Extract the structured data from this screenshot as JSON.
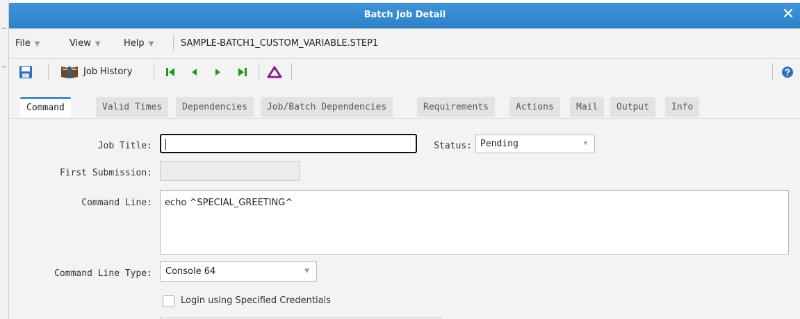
{
  "window": {
    "title": "Batch Job Detail"
  },
  "menu": {
    "file": "File",
    "view": "View",
    "help": "Help",
    "job_path": "SAMPLE-BATCH1_CUSTOM_VARIABLE.STEP1"
  },
  "toolbar": {
    "job_history": "Job History"
  },
  "tabs": [
    {
      "label": "Command"
    },
    {
      "label": "Valid Times"
    },
    {
      "label": "Dependencies"
    },
    {
      "label": "Job/Batch Dependencies"
    },
    {
      "label": "Requirements"
    },
    {
      "label": "Actions"
    },
    {
      "label": "Mail"
    },
    {
      "label": "Output"
    },
    {
      "label": "Info"
    }
  ],
  "form": {
    "job_title_label": "Job Title:",
    "job_title_value": "",
    "status_label": "Status:",
    "status_value": "Pending",
    "first_submission_label": "First Submission:",
    "first_submission_value": "",
    "command_line_label": "Command Line:",
    "command_line_value": "echo ^SPECIAL_GREETING^",
    "command_line_type_label": "Command Line Type:",
    "command_line_type_value": "Console 64",
    "login_credentials_label": "Login using Specified Credentials"
  },
  "colors": {
    "title_bar": "#3a8fd6",
    "active_tab_accent": "#3a8fd6",
    "first_last_arrows": "#1a9a1a",
    "triangle_icon": "#8b1a8b"
  },
  "icons": {
    "close": "close-icon",
    "save": "save-icon",
    "history": "book-icon",
    "first": "first-record-icon",
    "prev": "previous-record-icon",
    "next": "next-record-icon",
    "last": "last-record-icon",
    "delta": "triangle-icon",
    "help": "help-icon"
  }
}
